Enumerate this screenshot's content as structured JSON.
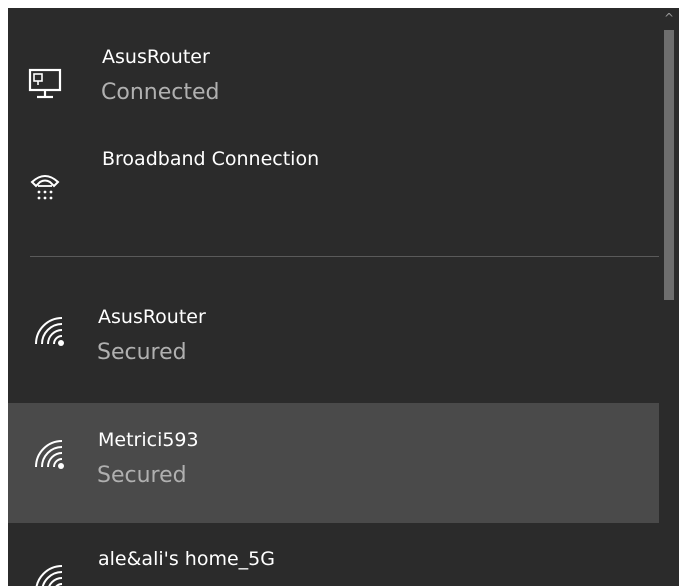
{
  "wired_connections": [
    {
      "name": "AsusRouter",
      "status": "Connected",
      "icon": "ethernet-computer-icon"
    },
    {
      "name": "Broadband Connection",
      "status": "",
      "icon": "dialup-phone-icon"
    }
  ],
  "wifi_networks": [
    {
      "name": "AsusRouter",
      "status": "Secured",
      "icon": "wifi-secured-icon"
    },
    {
      "name": "Metrici593",
      "status": "Secured",
      "icon": "wifi-secured-icon"
    },
    {
      "name": "ale&ali's home_5G",
      "status": "",
      "icon": "wifi-secured-icon"
    }
  ],
  "scrollbar": {
    "up_arrow": "^"
  },
  "colors": {
    "panel_bg": "#2b2b2b",
    "hover_bg": "#4a4a4a",
    "text_primary": "#ffffff",
    "text_secondary": "#b0b0b0"
  }
}
